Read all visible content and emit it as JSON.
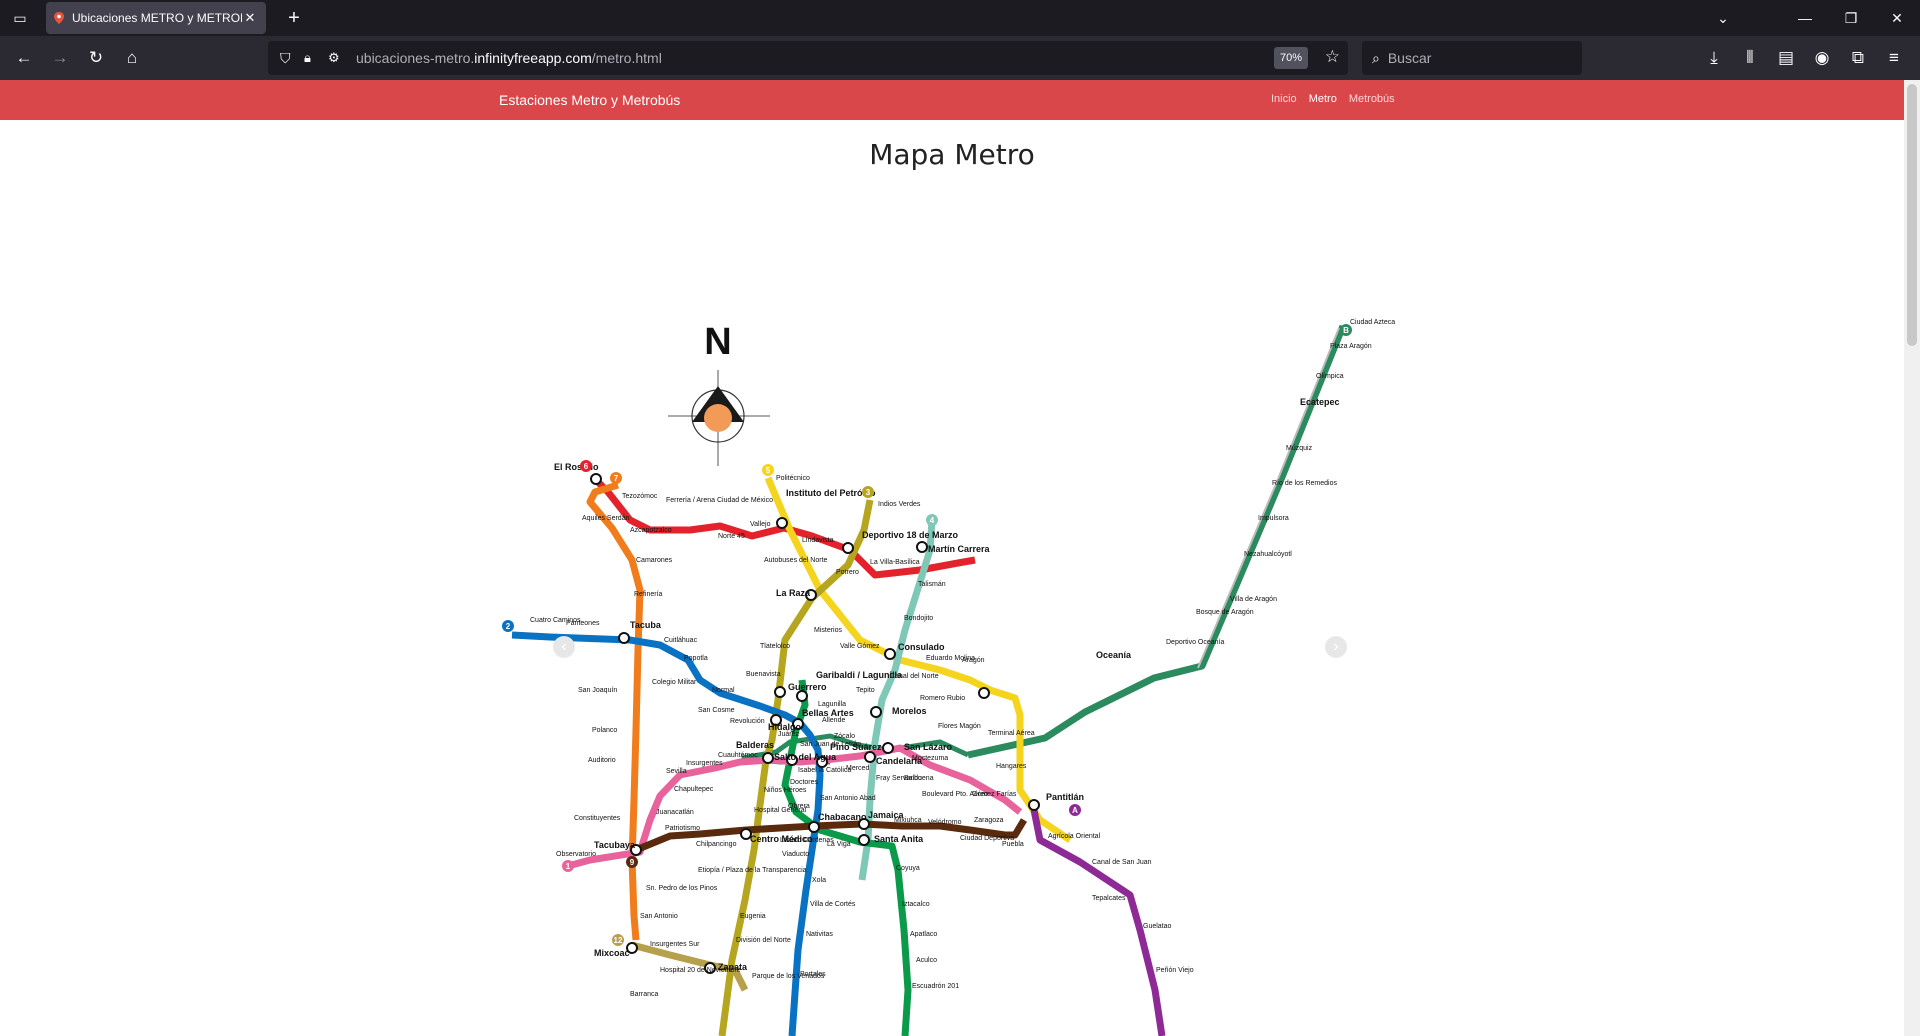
{
  "browser": {
    "tab_title": "Ubicaciones METRO y METROBÚS",
    "url_prefix": "ubicaciones-metro.",
    "url_domain": "infinityfreeapp.com",
    "url_path": "/metro.html",
    "zoom": "70%",
    "search_placeholder": "Buscar"
  },
  "site": {
    "brand": "Estaciones Metro y Metrobús",
    "nav": [
      "Inicio",
      "Metro",
      "Metrobús"
    ],
    "active_nav": "Metro"
  },
  "page": {
    "title": "Mapa Metro"
  },
  "map": {
    "compass_label": "N",
    "line_colors": {
      "1": "#e8629c",
      "2": "#0a72c3",
      "3": "#b5a51f",
      "4": "#7fc8b8",
      "5": "#f5d41e",
      "6": "#e3222b",
      "7": "#f07c1b",
      "8": "#0a9a4a",
      "9": "#5a2a0e",
      "A": "#8e2a96",
      "B": "#2b8a5e",
      "12": "#b6a04c"
    },
    "line_badges": [
      "1",
      "2",
      "3",
      "4",
      "5",
      "6",
      "7",
      "9",
      "12",
      "A",
      "B"
    ],
    "stations": [
      "Ciudad Azteca",
      "Plaza Aragón",
      "Olímpica",
      "Ecatepec",
      "Múzquiz",
      "Río de los Remedios",
      "Impulsora",
      "Nezahualcóyotl",
      "Villa de Aragón",
      "Bosque de Aragón",
      "Deportivo Oceanía",
      "Oceanía",
      "El Rosario",
      "Tezozómoc",
      "Ferrería / Arena Ciudad de México",
      "Azcapotzalco",
      "Norte 45",
      "Vallejo",
      "Instituto del Petróleo",
      "Lindavista",
      "Deportivo 18 de Marzo",
      "Martín Carrera",
      "Indios Verdes",
      "Politécnico",
      "Autobuses del Norte",
      "Potrero",
      "La Villa-Basílica",
      "Talismán",
      "La Raza",
      "Bondojito",
      "Misterios",
      "Valle Gómez",
      "Consulado",
      "Eduardo Molina",
      "Aragón",
      "Canal del Norte",
      "Aquiles Serdán",
      "Camarones",
      "Refinería",
      "Cuatro Caminos",
      "Panteones",
      "Tacuba",
      "Cuitláhuac",
      "Popotla",
      "Colegio Militar",
      "Normal",
      "San Cosme",
      "Revolución",
      "Tlatelolco",
      "Buenavista",
      "Guerrero",
      "Garibaldi / Lagunilla",
      "Lagunilla",
      "Tepito",
      "Morelos",
      "Romero Rubio",
      "Flores Magón",
      "Terminal Aérea",
      "Hidalgo",
      "Bellas Artes",
      "Allende",
      "Zócalo",
      "San Joaquín",
      "Juárez",
      "Balderas",
      "Salto del Agua",
      "San Juan de Letrán",
      "Isabel la Católica",
      "Pino Suárez",
      "Merced",
      "Candelaria",
      "San Lázaro",
      "Moctezuma",
      "Balbuena",
      "Hangares",
      "Polanco",
      "Auditorio",
      "Sevilla",
      "Insurgentes",
      "Cuauhtémoc",
      "Niños Héroes",
      "Doctores",
      "Obrera",
      "Fray Servando",
      "Boulevard Pto. Aéreo",
      "Gómez Farías",
      "Pantitlán",
      "Chapultepec",
      "Juanacatlán",
      "Hospital General",
      "San Antonio Abad",
      "Chabacano",
      "Jamaica",
      "Mixiuhca",
      "Velódromo",
      "Zaragoza",
      "Constituyentes",
      "Patriotismo",
      "Centro Médico",
      "Lázaro Cárdenas",
      "Viaducto",
      "La Viga",
      "Santa Anita",
      "Ciudad Deportiva",
      "Puebla",
      "Agrícola Oriental",
      "Canal de San Juan",
      "Tepalcates",
      "Guelatao",
      "Peñón Viejo",
      "Tacubaya",
      "Observatorio",
      "Chilpancingo",
      "Etiopía / Plaza de la Transparencia",
      "Xola",
      "Villa de Cortés",
      "Nativitas",
      "Portales",
      "Coyuya",
      "Iztacalco",
      "Apatlaco",
      "Aculco",
      "Escuadrón 201",
      "Sn. Pedro de los Pinos",
      "San Antonio",
      "Mixcoac",
      "Insurgentes Sur",
      "Hospital 20 de Noviembre",
      "Zapata",
      "Parque de los Venados",
      "Eugenia",
      "División del Norte",
      "Barranca"
    ]
  }
}
